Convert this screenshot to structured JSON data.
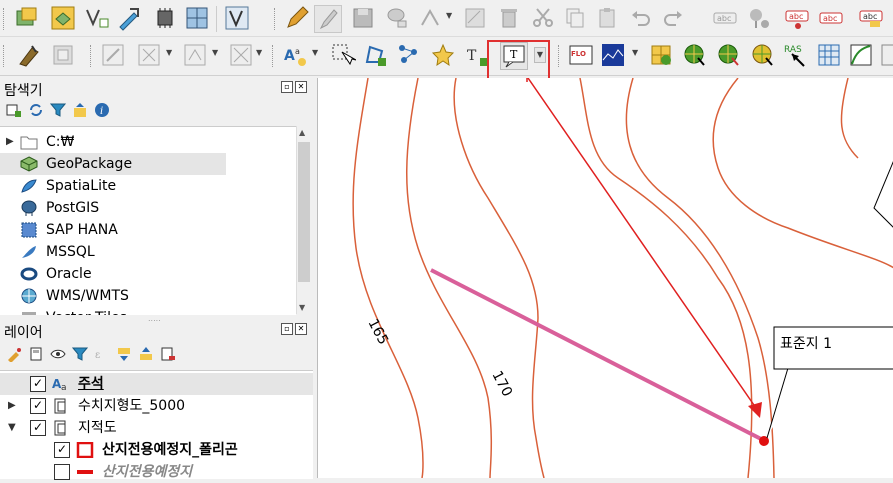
{
  "toolbar_top": {
    "icons": [
      "open-data-source-manager-icon",
      "digitize-icon",
      "vertex-tool-icon",
      "node-editor-icon",
      "gpu-chip-icon",
      "grid-layout-icon",
      "select-vertex-icon",
      "pencil-icon",
      "edit-pencil-icon",
      "save-edits-icon",
      "add-feature-icon",
      "move-feature-icon",
      "digitize-shape-icon",
      "delete-icon",
      "cut-icon",
      "copy-icon",
      "paste-icon",
      "undo-icon",
      "redo-icon",
      "label-abc-icon",
      "pin-label-icon",
      "abc-red-icon",
      "abc-label-icon",
      "abc-highlight-icon"
    ]
  },
  "toolbar_second": {
    "icons": [
      "snapping-icon",
      "topology-icon",
      "select-feature-icon",
      "field-calc-icon",
      "advanced-digitize-icon",
      "label-style-icon",
      "select-tool-icon",
      "polygon-add-icon",
      "vertex-add-icon",
      "star-icon",
      "text-add-icon",
      "text-annotation-icon",
      "flo2d-icon",
      "flo2d-profile-icon",
      "flo2d-grid-icon",
      "map-globe-icon",
      "globe-pointer-icon",
      "globe-cursor-icon",
      "ras-icon",
      "table-grid-icon",
      "curve-tool-icon"
    ],
    "ras_label": "RAS",
    "flo_label": "FLO"
  },
  "browser": {
    "title": "탐색기",
    "items": [
      {
        "label": "C:₩",
        "icon": "folder-icon",
        "expandable": true
      },
      {
        "label": "GeoPackage",
        "icon": "geopackage-icon",
        "selected": true
      },
      {
        "label": "SpatiaLite",
        "icon": "spatialite-icon"
      },
      {
        "label": "PostGIS",
        "icon": "postgis-icon"
      },
      {
        "label": "SAP HANA",
        "icon": "sap-hana-icon"
      },
      {
        "label": "MSSQL",
        "icon": "mssql-icon"
      },
      {
        "label": "Oracle",
        "icon": "oracle-icon"
      },
      {
        "label": "WMS/WMTS",
        "icon": "wms-globe-icon"
      },
      {
        "label": "Vector Tiles",
        "icon": "vector-tiles-icon"
      }
    ]
  },
  "layers": {
    "title": "레이어",
    "items": [
      {
        "label": "주석",
        "checked": true,
        "bold": true,
        "underline": true
      },
      {
        "label": "수치지형도_5000",
        "checked": true
      },
      {
        "label": "지적도",
        "checked": true,
        "expanded": true
      },
      {
        "label": "산지전용예정지_폴리곤",
        "checked": true,
        "bold": true
      },
      {
        "label": "산지전용예정지",
        "checked": false,
        "italic": true
      }
    ]
  },
  "map": {
    "contour_labels": [
      "165",
      "170"
    ],
    "callout_text": "표준지 1",
    "colors": {
      "contour": "#d9603a",
      "line": "#d9609a",
      "arrow": "#e02020",
      "point": "#e01010"
    }
  }
}
